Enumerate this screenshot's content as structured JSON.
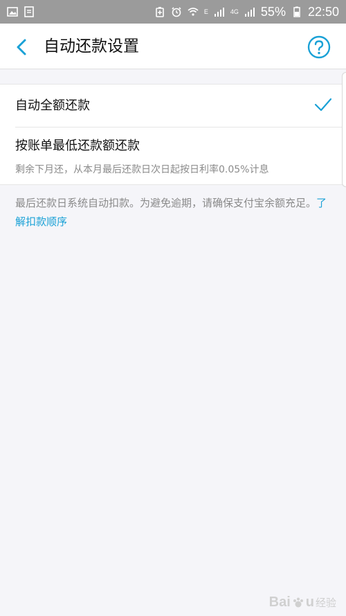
{
  "status_bar": {
    "battery": "55%",
    "time": "22:50",
    "signal_label": "4G",
    "network_label": "E",
    "icons": [
      "image-icon",
      "document-icon",
      "battery-saver-icon",
      "alarm-icon",
      "wifi-icon",
      "signal-icon",
      "signal-4g-icon",
      "battery-icon"
    ]
  },
  "nav": {
    "title": "自动还款设置",
    "back_icon": "chevron-left-icon",
    "help_icon": "help-circle-icon"
  },
  "options": [
    {
      "label": "自动全额还款",
      "selected": true
    },
    {
      "label": "按账单最低还款额还款",
      "description": "剩余下月还，从本月最后还款日次日起按日利率0.05%计息",
      "selected": false
    }
  ],
  "note": {
    "text": "最后还款日系统自动扣款。为避免逾期，请确保支付宝余额充足。",
    "link": "了解扣款顺序"
  },
  "watermark": {
    "brand": "Bai",
    "brand_end": "u",
    "cn": "经验"
  },
  "colors": {
    "accent": "#1aa1d6",
    "status_bar": "#9b9b9b",
    "background": "#f5f5f9"
  }
}
